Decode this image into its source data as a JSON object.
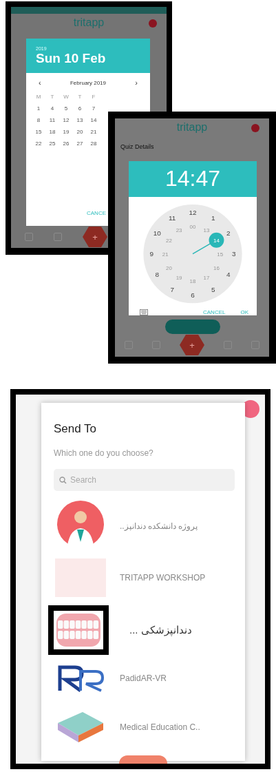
{
  "screens": [
    {
      "kind": "date_picker",
      "app_title": "tritapp",
      "year": "2019",
      "date": "Sun 10 Feb",
      "prev": "‹",
      "month": "February 2019",
      "next": "›",
      "weekdays": [
        "M",
        "T",
        "W",
        "T",
        "F"
      ],
      "days": [
        "1",
        "4",
        "5",
        "6",
        "7",
        "8",
        "11",
        "12",
        "13",
        "14",
        "15",
        "18",
        "19",
        "20",
        "21",
        "22",
        "25",
        "26",
        "27",
        "28"
      ],
      "action": "CANCE",
      "fab": "+"
    },
    {
      "kind": "time_picker",
      "app_title": "tritapp",
      "section_title": "Quiz Details",
      "time": "14:47",
      "outer": [
        {
          "label": "12",
          "selected": false
        },
        {
          "label": "1",
          "selected": false
        },
        {
          "label": "2",
          "selected": false
        },
        {
          "label": "3",
          "selected": false
        },
        {
          "label": "4",
          "selected": false
        },
        {
          "label": "5",
          "selected": false
        },
        {
          "label": "6",
          "selected": false
        },
        {
          "label": "7",
          "selected": false
        },
        {
          "label": "8",
          "selected": false
        },
        {
          "label": "9",
          "selected": false
        },
        {
          "label": "10",
          "selected": false
        },
        {
          "label": "11",
          "selected": false
        }
      ],
      "inner": [
        {
          "label": "00",
          "selected": false
        },
        {
          "label": "13",
          "selected": false
        },
        {
          "label": "14",
          "selected": true
        },
        {
          "label": "15",
          "selected": false
        },
        {
          "label": "16",
          "selected": false
        },
        {
          "label": "17",
          "selected": false
        },
        {
          "label": "18",
          "selected": false
        },
        {
          "label": "19",
          "selected": false
        },
        {
          "label": "20",
          "selected": false
        },
        {
          "label": "21",
          "selected": false
        },
        {
          "label": "22",
          "selected": false
        },
        {
          "label": "23",
          "selected": false
        }
      ],
      "buttons": [
        "CANCEL",
        "OK"
      ],
      "fab": "+"
    },
    {
      "kind": "share_dialog",
      "title": "Send To",
      "subtitle": "Which one do you choose?",
      "search_placeholder": "Search",
      "items": [
        {
          "name": "پروژه دانشکده دندانپز..",
          "kind": "doctor",
          "highlighted": false
        },
        {
          "name": "TRITAPP WORKSHOP",
          "kind": "logo",
          "highlighted": false
        },
        {
          "name": "دندانپزشکی ...",
          "kind": "teeth",
          "highlighted": true
        },
        {
          "name": "PadidAR-VR",
          "kind": "pr",
          "highlighted": false
        },
        {
          "name": "Medical Education C..",
          "kind": "book",
          "highlighted": false
        }
      ]
    }
  ]
}
